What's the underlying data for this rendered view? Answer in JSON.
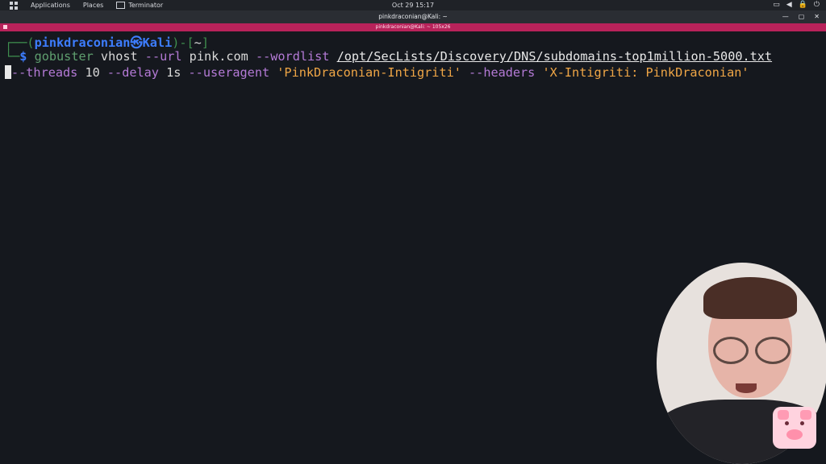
{
  "topbar": {
    "applications": "Applications",
    "places": "Places",
    "terminator": "Terminator",
    "clock": "Oct 29  15:17"
  },
  "titlebar": {
    "title": "pinkdraconian@Kali: ~",
    "subtitle": "pinkdraconian@Kali: ~ 105x26"
  },
  "terminal": {
    "prompt_box_open": "┌──(",
    "user": "pinkdraconian",
    "at_glyph": "㉿",
    "host": "Kali",
    "prompt_box_close": ")-[",
    "cwd": "~",
    "prompt_end": "]",
    "prompt_corner": "└─",
    "dollar": "$",
    "cmd": "gobuster",
    "sub": "vhost",
    "opt_url": "--url",
    "url": "pink.com",
    "opt_wordlist": "--wordlist",
    "wordlist": "/opt/SecLists/Discovery/DNS/subdomains-top1million-5000.txt",
    "opt_threads": "--threads",
    "threads": "10",
    "opt_delay": "--delay",
    "delay": "1s",
    "opt_useragent": "--useragent",
    "useragent": "'PinkDraconian-Intigriti'",
    "opt_headers": "--headers",
    "headers": "'X-Intigriti: PinkDraconian'"
  }
}
